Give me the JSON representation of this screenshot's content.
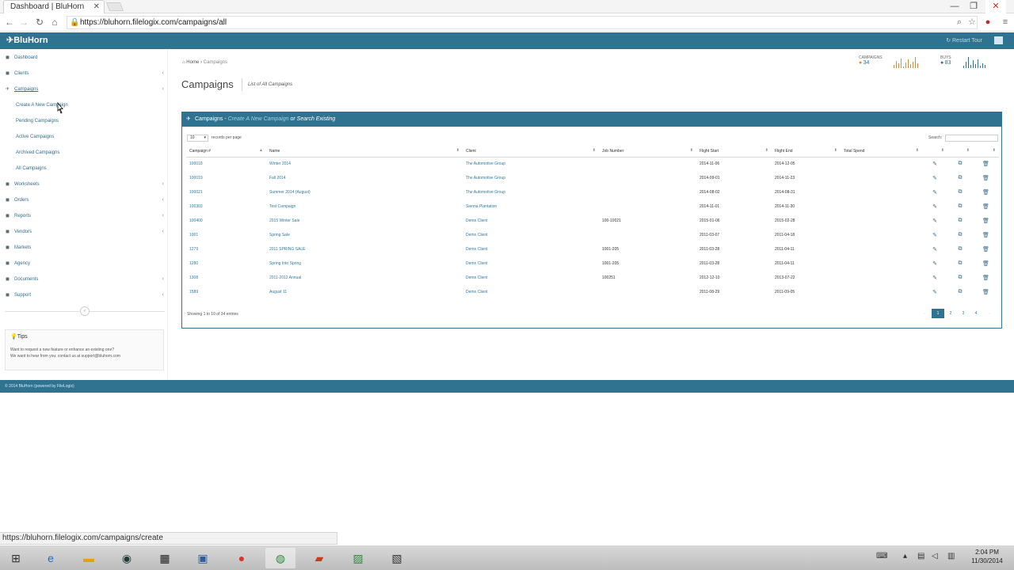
{
  "browser": {
    "tab_title": "Dashboard | BluHorn",
    "url": "https://bluhorn.filelogix.com/campaigns/all",
    "status_url": "https://bluhorn.filelogix.com/campaigns/create"
  },
  "header": {
    "brand": "BluHorn",
    "restart_tour": "Restart Tour"
  },
  "sidebar": {
    "items": [
      {
        "label": "Dashboard",
        "icon": "dashboard-icon"
      },
      {
        "label": "Clients",
        "icon": "clients-icon"
      },
      {
        "label": "Campaigns",
        "icon": "campaigns-icon"
      },
      {
        "label": "Worksheets",
        "icon": "worksheets-icon"
      },
      {
        "label": "Orders",
        "icon": "orders-icon"
      },
      {
        "label": "Reports",
        "icon": "reports-icon"
      },
      {
        "label": "Vendors",
        "icon": "vendors-icon"
      },
      {
        "label": "Markets",
        "icon": "markets-icon"
      },
      {
        "label": "Agency",
        "icon": "agency-icon"
      },
      {
        "label": "Documents",
        "icon": "documents-icon"
      },
      {
        "label": "Support",
        "icon": "support-icon"
      }
    ],
    "campaign_subitems": [
      {
        "label": "Create A New Campaign"
      },
      {
        "label": "Pending Campaigns"
      },
      {
        "label": "Active Campaigns"
      },
      {
        "label": "Archived Campaigns"
      },
      {
        "label": "All Campaigns"
      }
    ],
    "tips": {
      "title": "Tips",
      "line1": "Want to request a new feature or enhance an existing one?",
      "line2": "We want to hear from you: contact us at support@bluhorn.com"
    }
  },
  "breadcrumb": {
    "home": "Home",
    "current": "Campaigns"
  },
  "page": {
    "title": "Campaigns",
    "subtitle": "List of All Campaigns"
  },
  "stats": {
    "campaigns_label": "CAMPAIGNS",
    "campaigns_value": "34",
    "buys_label": "BUYS",
    "buys_value": "83",
    "campaigns_spark": [
      3,
      8,
      5,
      10,
      2,
      6,
      9,
      4,
      7,
      12,
      5
    ],
    "buys_spark": [
      2,
      6,
      11,
      3,
      8,
      4,
      9,
      2,
      5,
      3
    ]
  },
  "panel": {
    "title": "Campaigns",
    "dash": " - ",
    "create_link": "Create A New Campaign",
    "or_search": " or Search Existing",
    "length_value": "10",
    "length_label": "records per page",
    "search_label": "Search:",
    "info": "Showing 1 to 10 of 34 entries"
  },
  "table": {
    "headers": [
      "Campaign #",
      "Name",
      "Client",
      "Job Number",
      "Flight Start",
      "Flight End",
      "Total Spend"
    ],
    "rows": [
      [
        "100018",
        "Winter 2014",
        "The Automotive Group",
        "",
        "2014-11-06",
        "2014-12-05",
        ""
      ],
      [
        "100019",
        "Fall 2014",
        "The Automotive Group",
        "",
        "2014-09-01",
        "2014-11-23",
        ""
      ],
      [
        "100021",
        "Summer 2014 (August)",
        "The Automotive Group",
        "",
        "2014-08-02",
        "2014-08-31",
        ""
      ],
      [
        "100303",
        "Test Campaign",
        "Sienna Plantation",
        "",
        "2014-11-01",
        "2014-11-30",
        ""
      ],
      [
        "100400",
        "2015 Winter Sale",
        "Demo Client",
        "100-10021",
        "2015-01-06",
        "2015-02-28",
        ""
      ],
      [
        "1001",
        "Spring Sale",
        "Demo Client",
        "",
        "2011-03-07",
        "2011-04-18",
        ""
      ],
      [
        "1279",
        "2011 SPRING SALE",
        "Demo Client",
        "1001-205",
        "2011-03-28",
        "2011-04-11",
        ""
      ],
      [
        "1280",
        "Spring Into Spring",
        "Demo Client",
        "1001-205",
        "2011-03-28",
        "2011-04-11",
        ""
      ],
      [
        "1308",
        "2011-2012 Annual",
        "Demo Client",
        "100251",
        "2012-12-10",
        "2013-07-22",
        ""
      ],
      [
        "1589",
        "August 11",
        "Demo Client",
        "",
        "2011-08-29",
        "2011-09-05",
        ""
      ]
    ]
  },
  "pager": {
    "prev": "←",
    "pages": [
      "1",
      "2",
      "3",
      "4"
    ],
    "next": "→",
    "active": "1"
  },
  "footer": {
    "text": "© 2014 BluHorn (powered by FileLogix)"
  },
  "taskbar": {
    "time": "2:04 PM",
    "date": "11/30/2014"
  },
  "colors": {
    "brand": "#2f7390",
    "link": "#2f7aa0",
    "accent": "#e08a2b"
  }
}
